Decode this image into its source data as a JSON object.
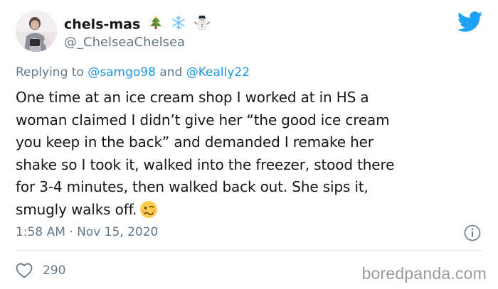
{
  "author": {
    "display_name": "chels-mas",
    "name_emojis": [
      "christmas-tree",
      "snowflake",
      "snowman"
    ],
    "handle": "@_ChelseaChelsea"
  },
  "reply": {
    "prefix": "Replying to ",
    "mention_1": "@samgo98",
    "conjunction": " and ",
    "mention_2": "@Keally22"
  },
  "tweet": {
    "lines": [
      "One time at an ice cream shop I worked at in HS a",
      "woman claimed I didn’t give her “the good ice cream",
      "you keep in the back” and demanded I remake her",
      "shake so I took it, walked into the freezer, stood there",
      "for 3-4 minutes, then walked back out. She sips it,",
      "smugly walks off."
    ],
    "end_emoji": "woozy-face"
  },
  "timestamp": "1:58 AM · Nov 15, 2020",
  "likes": "290",
  "watermark": "boredpanda.com",
  "colors": {
    "twitter_blue": "#1DA1F2",
    "mention_blue": "#1B95E0",
    "secondary_text": "#657786",
    "divider": "#E1E8ED"
  }
}
